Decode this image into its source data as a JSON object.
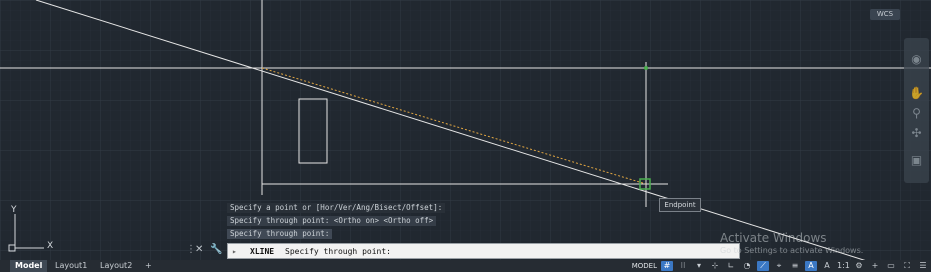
{
  "viewport": {
    "wcs_label": "WCS",
    "ucs": {
      "y_label": "Y",
      "x_label": "X"
    }
  },
  "tooltip": {
    "text": "Endpoint"
  },
  "command_history": [
    "Specify a point or [Hor/Ver/Ang/Bisect/Offset]:",
    "Specify through point:  <Ortho on>  <Ortho off>",
    "Specify through point:"
  ],
  "command_line": {
    "command": "XLINE",
    "prompt": "Specify through point:"
  },
  "watermark": {
    "title": "Activate Windows",
    "subtitle": "Go to Settings to activate Windows."
  },
  "layout_tabs": [
    "Model",
    "Layout1",
    "Layout2"
  ],
  "add_tab_symbol": "+",
  "status_bar": {
    "model_label": "MODEL",
    "scale_label": "1:1"
  },
  "colors": {
    "background": "#212830",
    "crosshair": "#ffffff",
    "snap_marker": "#4caf50",
    "tracking": "#e2a742"
  },
  "icons": [
    "close-icon",
    "wrench-icon",
    "grid-icon",
    "snap-icon",
    "ortho-icon",
    "osnap-icon",
    "gear-icon",
    "plus-icon",
    "menu-icon"
  ]
}
